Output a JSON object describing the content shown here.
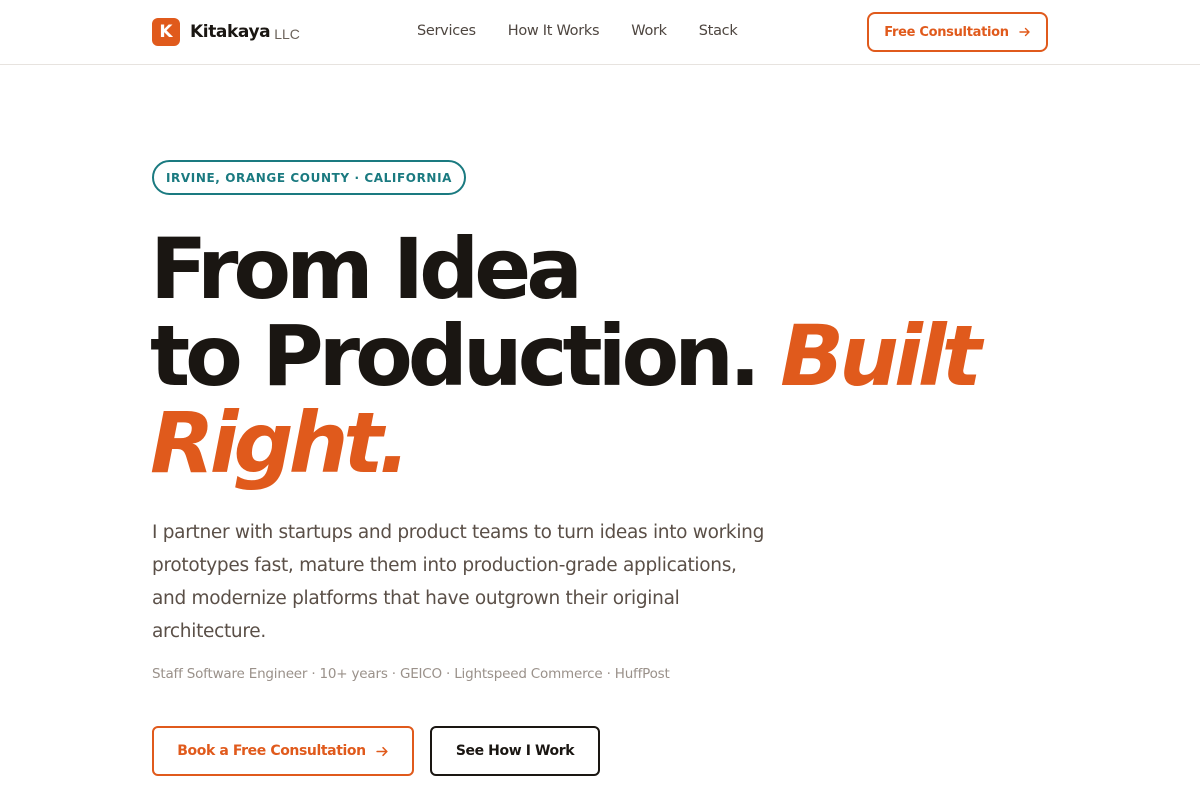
{
  "brand": {
    "mark": "K",
    "name": "Kitakaya",
    "suffix": "LLC"
  },
  "nav": {
    "links": [
      {
        "label": "Services"
      },
      {
        "label": "How It Works"
      },
      {
        "label": "Work"
      },
      {
        "label": "Stack"
      }
    ],
    "cta_label": "Free Consultation",
    "cta_icon": "arrow-right-icon"
  },
  "hero": {
    "location_badge": "IRVINE, ORANGE COUNTY · CALIFORNIA",
    "headline_line1": "From Idea",
    "headline_line2": "to Production.",
    "headline_accent_1": "Built",
    "headline_accent_2": "Right.",
    "lead": "I partner with startups and product teams to turn ideas into working prototypes fast, mature them into production-grade applications, and modernize platforms that have outgrown their original architecture.",
    "credentials": "Staff Software Engineer · 10+ years · GEICO · Lightspeed Commerce · HuffPost",
    "primary_button": "Book a Free Consultation",
    "secondary_button": "See How I Work"
  },
  "colors": {
    "accent": "#e05a1c",
    "teal": "#1a7a80",
    "text": "#1a1612"
  }
}
